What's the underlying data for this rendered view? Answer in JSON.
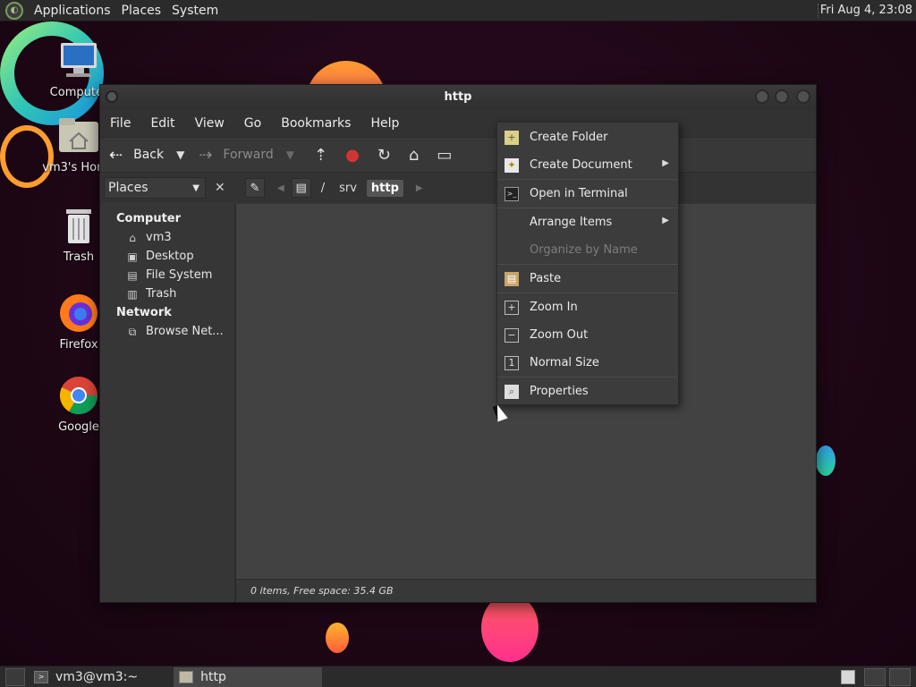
{
  "top_panel": {
    "menus": [
      "Applications",
      "Places",
      "System"
    ],
    "clock": "Fri Aug  4, 23:08"
  },
  "desktop_icons": [
    {
      "label": "Computer",
      "icon": "computer-icon"
    },
    {
      "label": "vm3's Home",
      "icon": "home-folder-icon"
    },
    {
      "label": "Trash",
      "icon": "trash-icon"
    },
    {
      "label": "Firefox",
      "icon": "firefox-icon"
    },
    {
      "label": "Google",
      "icon": "chrome-icon"
    }
  ],
  "window": {
    "title": "http",
    "menubar": [
      "File",
      "Edit",
      "View",
      "Go",
      "Bookmarks",
      "Help"
    ],
    "toolbar": {
      "back_label": "Back",
      "forward_label": "Forward"
    },
    "sidebar_selector": "Places",
    "path": [
      "/",
      "srv",
      "http"
    ],
    "sidebar": {
      "computer_heading": "Computer",
      "computer_items": [
        {
          "label": "vm3",
          "icon": "home-icon"
        },
        {
          "label": "Desktop",
          "icon": "desktop-icon"
        },
        {
          "label": "File System",
          "icon": "drive-icon"
        },
        {
          "label": "Trash",
          "icon": "trash-icon"
        }
      ],
      "network_heading": "Network",
      "network_items": [
        {
          "label": "Browse Net...",
          "icon": "network-icon"
        }
      ]
    },
    "status": "0 items, Free space: 35.4 GB"
  },
  "context_menu": {
    "items": [
      {
        "label": "Create Folder",
        "icon": "folder-new-icon",
        "enabled": true
      },
      {
        "label": "Create Document",
        "icon": "document-new-icon",
        "enabled": true,
        "submenu": true
      },
      {
        "label": "Open in Terminal",
        "icon": "terminal-icon",
        "enabled": true
      },
      {
        "label": "Arrange Items",
        "enabled": true,
        "submenu": true
      },
      {
        "label": "Organize by Name",
        "enabled": false
      },
      {
        "label": "Paste",
        "icon": "paste-icon",
        "enabled": true
      },
      {
        "label": "Zoom In",
        "icon": "zoom-in-icon",
        "enabled": true
      },
      {
        "label": "Zoom Out",
        "icon": "zoom-out-icon",
        "enabled": true
      },
      {
        "label": "Normal Size",
        "icon": "zoom-normal-icon",
        "enabled": true
      },
      {
        "label": "Properties",
        "icon": "properties-icon",
        "enabled": true
      }
    ]
  },
  "bottom_panel": {
    "tasks": [
      {
        "label": "vm3@vm3:~",
        "icon": "terminal-icon"
      },
      {
        "label": "http",
        "icon": "folder-icon"
      }
    ]
  }
}
